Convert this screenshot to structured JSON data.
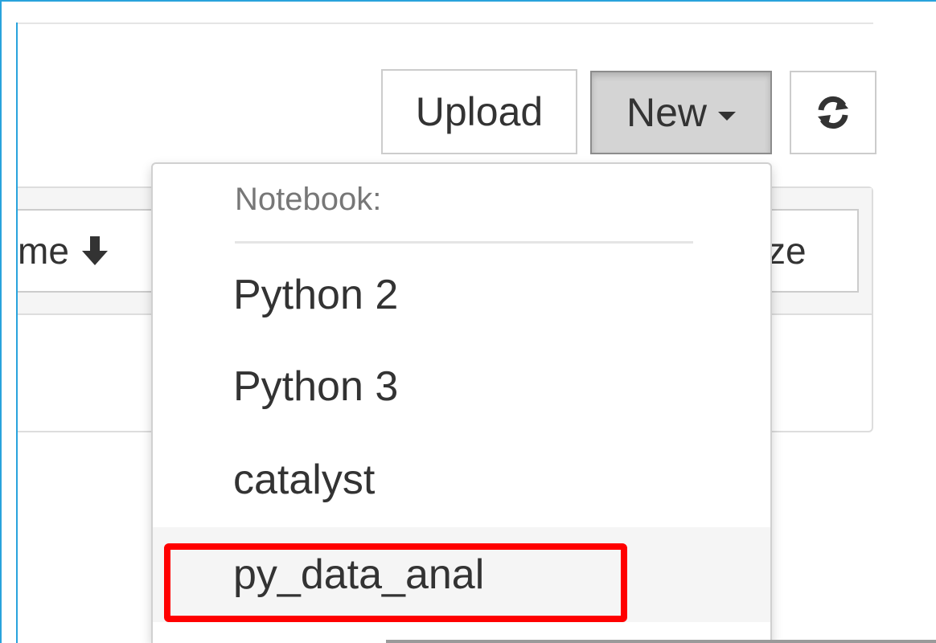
{
  "toolbar": {
    "upload_label": "Upload",
    "new_label": "New",
    "refresh_icon": "refresh-icon"
  },
  "file_list": {
    "name_column_label": "me",
    "name_sort_icon": "arrow-down-icon",
    "size_column_label": "ze"
  },
  "new_menu": {
    "section_header": "Notebook:",
    "items": [
      {
        "label": "Python 2"
      },
      {
        "label": "Python 3"
      },
      {
        "label": "catalyst"
      },
      {
        "label": "py_data_anal"
      }
    ]
  },
  "colors": {
    "highlight": "#ff0000",
    "frame": "#29a3dc",
    "active_button_bg": "#d4d4d4"
  }
}
